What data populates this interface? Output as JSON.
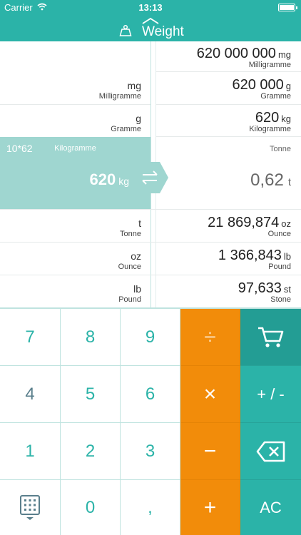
{
  "status_bar": {
    "carrier": "Carrier",
    "time": "13:13"
  },
  "header": {
    "title": "Weight"
  },
  "left_rows": [
    {
      "value": "mg",
      "name": "Milligramme"
    },
    {
      "value": "g",
      "name": "Gramme"
    },
    {
      "value": "t",
      "name": "Tonne"
    },
    {
      "value": "oz",
      "name": "Ounce"
    },
    {
      "value": "lb",
      "name": "Pound"
    }
  ],
  "right_rows": [
    {
      "value": "620 000 000",
      "unit": "mg",
      "name": "Milligramme"
    },
    {
      "value": "620 000",
      "unit": "g",
      "name": "Gramme"
    },
    {
      "value": "620",
      "unit": "kg",
      "name": "Kilogramme"
    },
    {
      "value": "21 869,874",
      "unit": "oz",
      "name": "Ounce"
    },
    {
      "value": "1 366,843",
      "unit": "lb",
      "name": "Pound"
    },
    {
      "value": "97,633",
      "unit": "st",
      "name": "Stone"
    }
  ],
  "selected_input": {
    "expression": "10*62",
    "unit_name": "Kilogramme",
    "value": "620",
    "unit": "kg"
  },
  "output": {
    "unit_name": "Tonne",
    "value": "0,62",
    "unit": "t"
  },
  "keypad": {
    "k7": "7",
    "k8": "8",
    "k9": "9",
    "divide": "÷",
    "k4": "4",
    "k5": "5",
    "k6": "6",
    "multiply": "×",
    "sign": "+ / -",
    "k1": "1",
    "k2": "2",
    "k3": "3",
    "minus": "−",
    "k0": "0",
    "comma": ",",
    "plus": "+",
    "clear": "AC"
  },
  "colors": {
    "teal": "#2bb3a8",
    "orange": "#f28c0a",
    "selected_bg": "#9fd6d0"
  },
  "icons": [
    "wifi-icon",
    "battery-icon",
    "weight-icon",
    "chevron-up-icon",
    "swap-icon",
    "cart-icon",
    "backspace-icon",
    "keyboard-icon"
  ]
}
